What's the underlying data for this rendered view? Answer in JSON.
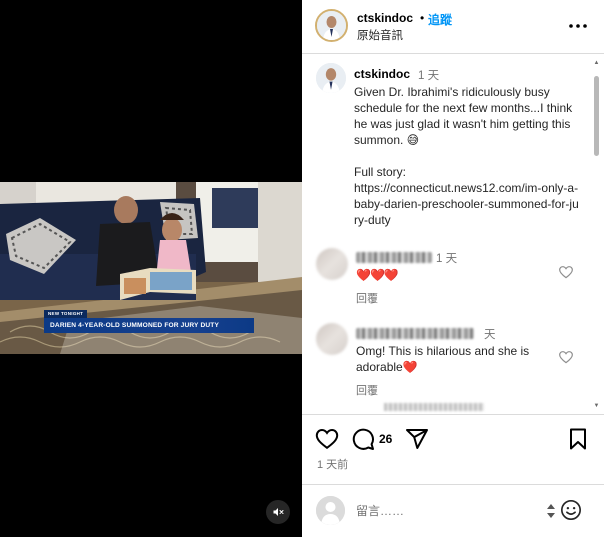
{
  "post": {
    "username": "ctskindoc",
    "separator": "•",
    "follow_label": "追蹤",
    "audio_label": "原始音訊",
    "more_icon": "more-horizontal-icon"
  },
  "video": {
    "news_tag": "NEW TONIGHT",
    "headline": "DARIEN 4-YEAR-OLD SUMMONED FOR JURY DUTY",
    "mute_icon": "speaker-muted-icon"
  },
  "caption": {
    "username": "ctskindoc",
    "time": "1 天",
    "text": "Given Dr. Ibrahimi's ridiculously busy schedule for the next few months...I think he was just glad it wasn't him getting this summon. 😅",
    "story_label": "Full story:",
    "story_url": "https://connecticut.news12.com/im-only-a-baby-darien-preschooler-summoned-for-jury-duty"
  },
  "comments": [
    {
      "time": "1 天",
      "text": "❤️❤️❤️",
      "reply_label": "回覆"
    },
    {
      "time_suffix": "天",
      "text": "Omg! This is hilarious and she is adorable❤️",
      "reply_label": "回覆"
    }
  ],
  "actions": {
    "like_icon": "heart-icon",
    "comment_icon": "comment-icon",
    "share_icon": "share-icon",
    "save_icon": "bookmark-icon",
    "comment_count": "26",
    "date": "1 天前"
  },
  "input": {
    "placeholder": "留言……",
    "emoji_icon": "emoji-icon"
  },
  "colors": {
    "link_blue": "#0095f6",
    "muted_text": "#737373",
    "divider": "#dbdbdb",
    "news_blue": "#0c3a86"
  }
}
